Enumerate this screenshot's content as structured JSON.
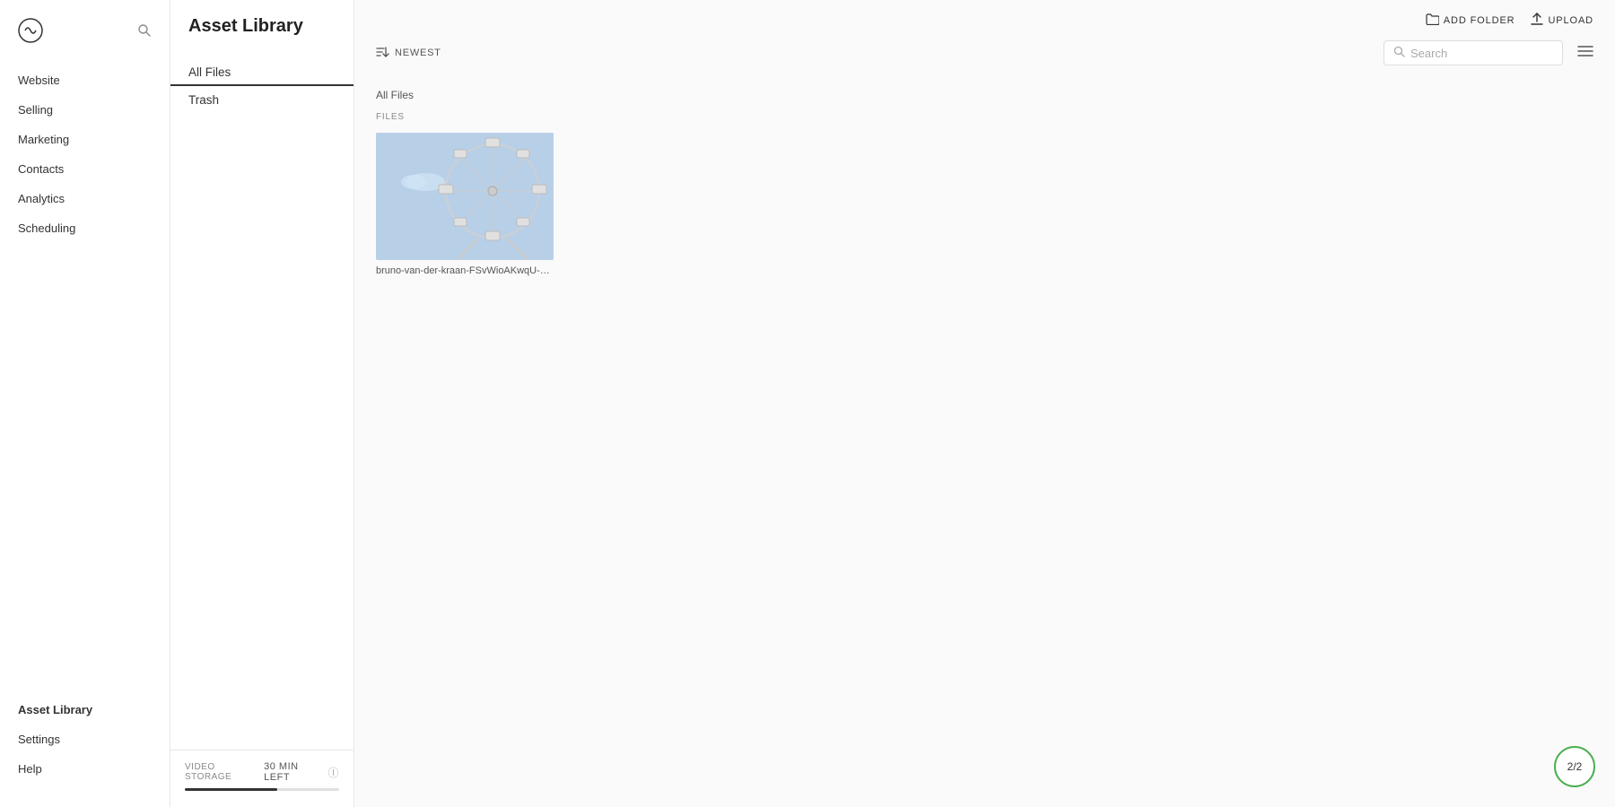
{
  "sidebar": {
    "logo_aria": "Squarespace logo",
    "nav_items": [
      {
        "label": "Website",
        "id": "website"
      },
      {
        "label": "Selling",
        "id": "selling"
      },
      {
        "label": "Marketing",
        "id": "marketing"
      },
      {
        "label": "Contacts",
        "id": "contacts"
      },
      {
        "label": "Analytics",
        "id": "analytics"
      },
      {
        "label": "Scheduling",
        "id": "scheduling"
      }
    ],
    "bottom_items": [
      {
        "label": "Asset Library",
        "id": "asset-library",
        "active": true
      },
      {
        "label": "Settings",
        "id": "settings"
      },
      {
        "label": "Help",
        "id": "help"
      }
    ]
  },
  "folder_panel": {
    "title": "Asset Library",
    "nav_items": [
      {
        "label": "All Files",
        "id": "all-files",
        "active": true
      },
      {
        "label": "Trash",
        "id": "trash"
      }
    ],
    "footer": {
      "storage_label": "VIDEO STORAGE",
      "storage_time": "30 MIN LEFT",
      "help_icon": "question-circle-icon"
    }
  },
  "toolbar": {
    "sort_label": "NEWEST",
    "sort_icon": "sort-icon",
    "search_placeholder": "Search",
    "view_toggle_icon": "grid-view-icon",
    "add_folder_label": "ADD FOLDER",
    "add_folder_icon": "folder-add-icon",
    "upload_label": "UPLOAD",
    "upload_icon": "upload-icon"
  },
  "content": {
    "breadcrumb": "All Files",
    "section_label": "FILES",
    "files": [
      {
        "id": "file-1",
        "name": "bruno-van-der-kraan-FSvWioAKwqU-unsplas...",
        "type": "image",
        "thumb_color": "#b8cfe0"
      }
    ]
  },
  "badge": {
    "label": "2/2"
  }
}
